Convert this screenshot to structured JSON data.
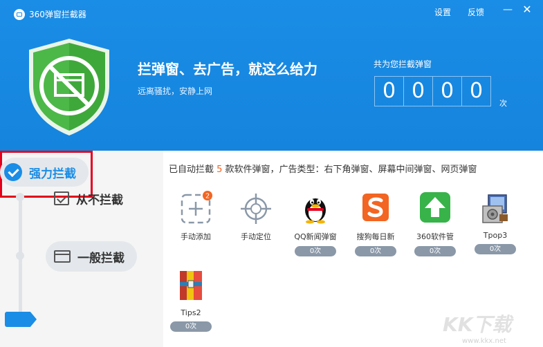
{
  "window": {
    "title": "360弹窗拦截器",
    "settings_label": "设置",
    "feedback_label": "反馈",
    "minimize_glyph": "—",
    "close_glyph": "✕"
  },
  "banner": {
    "headline": "拦弹窗、去广告，就这么给力",
    "subline": "远离骚扰，安静上网",
    "counter_label": "共为您拦截弹窗",
    "counter_digits": [
      "0",
      "0",
      "0",
      "0"
    ],
    "counter_unit": "次"
  },
  "modes": {
    "never_label": "从不拦截",
    "normal_label": "一般拦截",
    "strong_label": "强力拦截",
    "selected": "strong"
  },
  "summary": {
    "prefix": "已自动拦截 ",
    "count": "5",
    "suffix": " 款软件弹窗，广告类型：右下角弹窗、屏幕中间弹窗、网页弹窗"
  },
  "tools": {
    "manual_add_label": "手动添加",
    "manual_add_badge": "2",
    "manual_locate_label": "手动定位"
  },
  "apps": [
    {
      "name": "QQ新闻弹窗",
      "count": "0次"
    },
    {
      "name": "搜狗每日新",
      "count": "0次"
    },
    {
      "name": "360软件管",
      "count": "0次"
    },
    {
      "name": "Tpop3",
      "count": "0次"
    },
    {
      "name": "Tips2",
      "count": "0次"
    }
  ],
  "watermark": {
    "main": "KK下载",
    "sub": "www.kkx.net"
  },
  "colors": {
    "header_blue": "#1a8de6",
    "shield_green": "#4cb848",
    "highlight_red": "#e3001b",
    "count_orange": "#f26522"
  }
}
